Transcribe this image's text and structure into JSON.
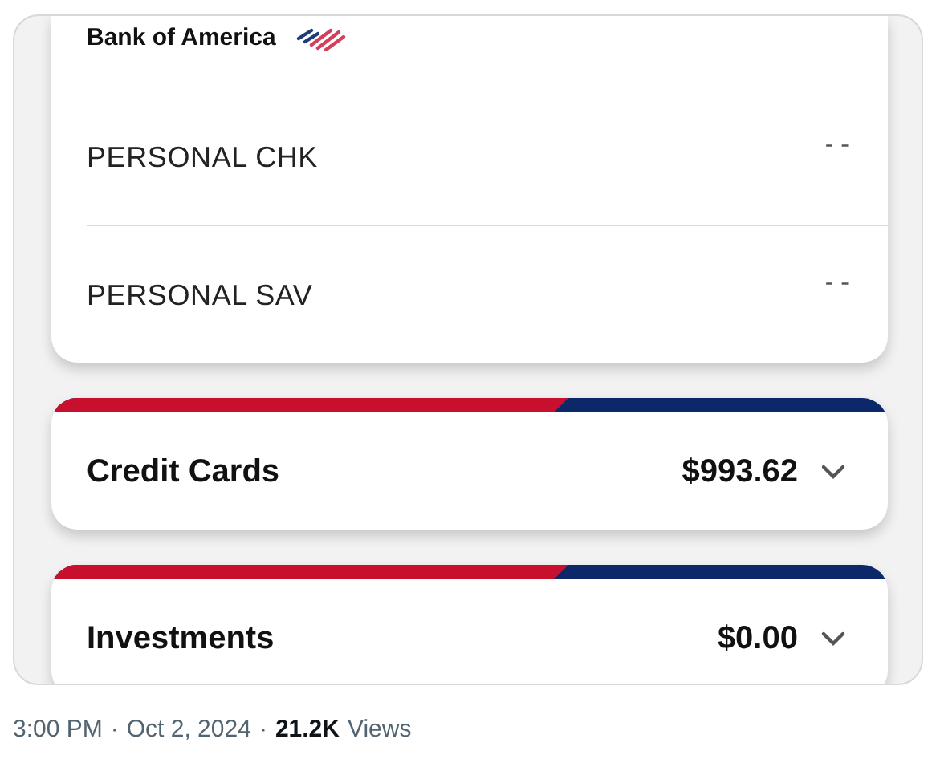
{
  "accounts_card": {
    "bank_name": "Bank of America",
    "rows": [
      {
        "name": "PERSONAL CHK",
        "value": "- -"
      },
      {
        "name": "PERSONAL SAV",
        "value": "- -"
      }
    ]
  },
  "sections": [
    {
      "title": "Credit Cards",
      "amount": "$993.62",
      "expanded": false
    },
    {
      "title": "Investments",
      "amount": "$0.00",
      "expanded": false
    }
  ],
  "footer": [
    {
      "text": "3:00 PM",
      "kind": "meta"
    },
    {
      "text": "·",
      "kind": "meta"
    },
    {
      "text": "Oct 2, 2024",
      "kind": "meta"
    },
    {
      "text": "·",
      "kind": "meta"
    },
    {
      "text": "21.2K",
      "kind": "count"
    },
    {
      "text": "Views",
      "kind": "meta"
    }
  ]
}
